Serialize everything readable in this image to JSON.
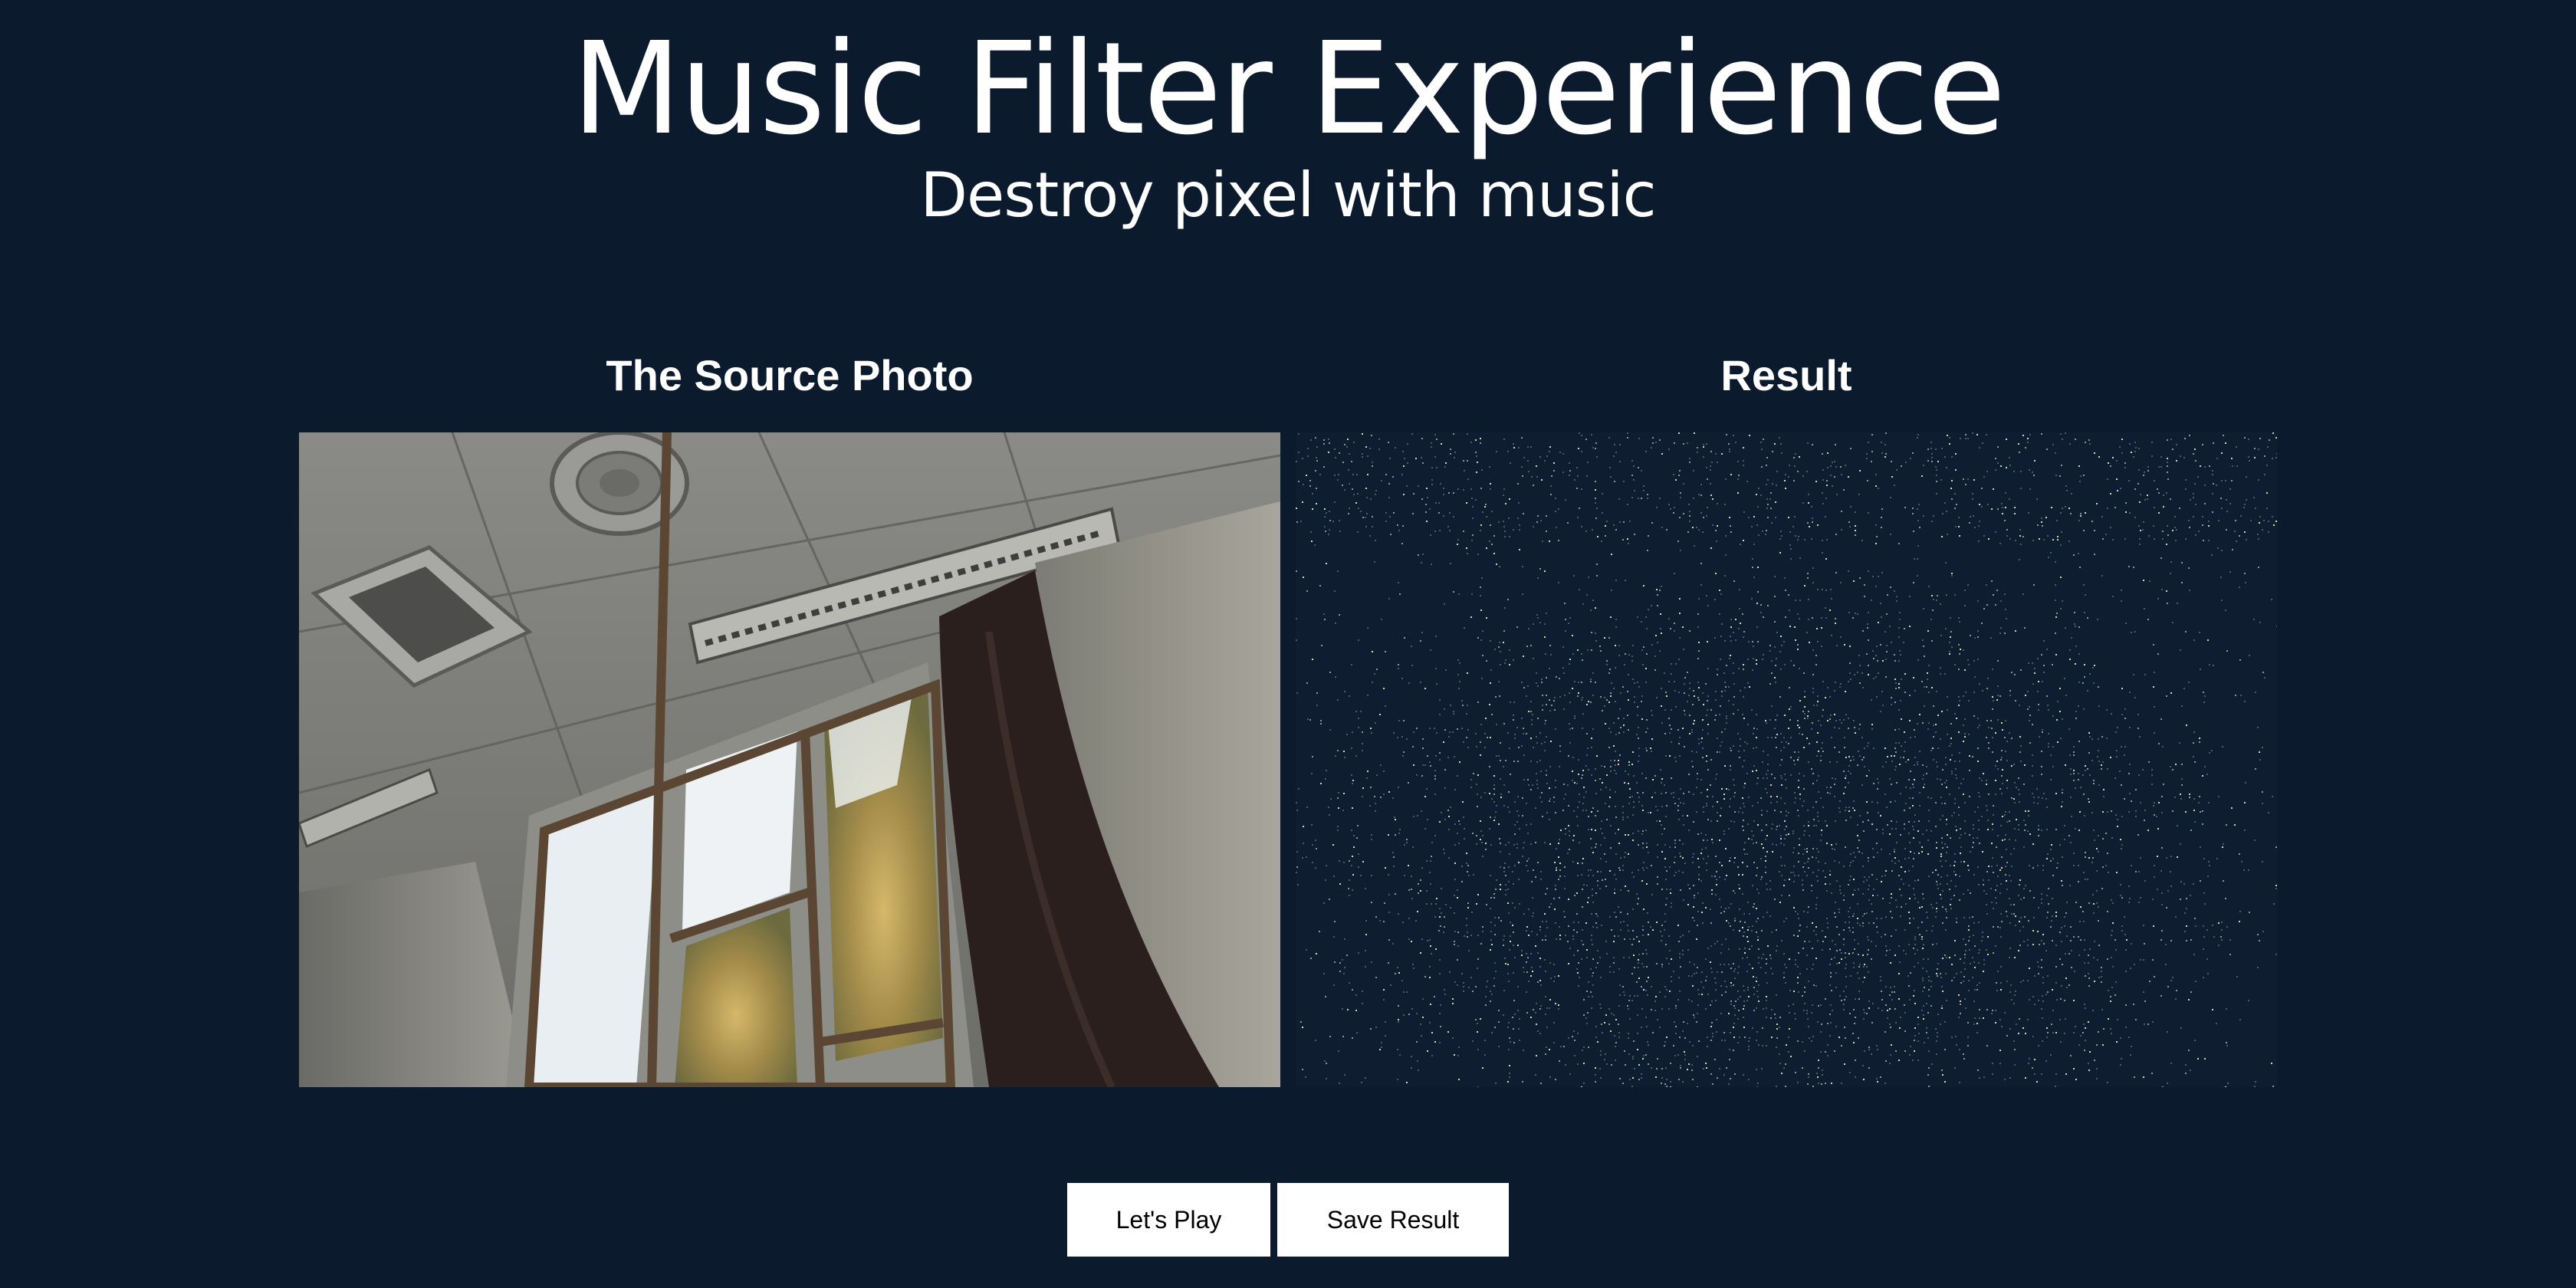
{
  "header": {
    "title": "Music Filter Experience",
    "subtitle": "Destroy pixel with music"
  },
  "panels": {
    "source": {
      "heading": "The Source Photo"
    },
    "result": {
      "heading": "Result"
    }
  },
  "actions": {
    "play_label": "Let's Play",
    "save_label": "Save Result"
  },
  "colors": {
    "background": "#0b1a2d",
    "button_background": "#ffffff",
    "text": "#ffffff"
  }
}
